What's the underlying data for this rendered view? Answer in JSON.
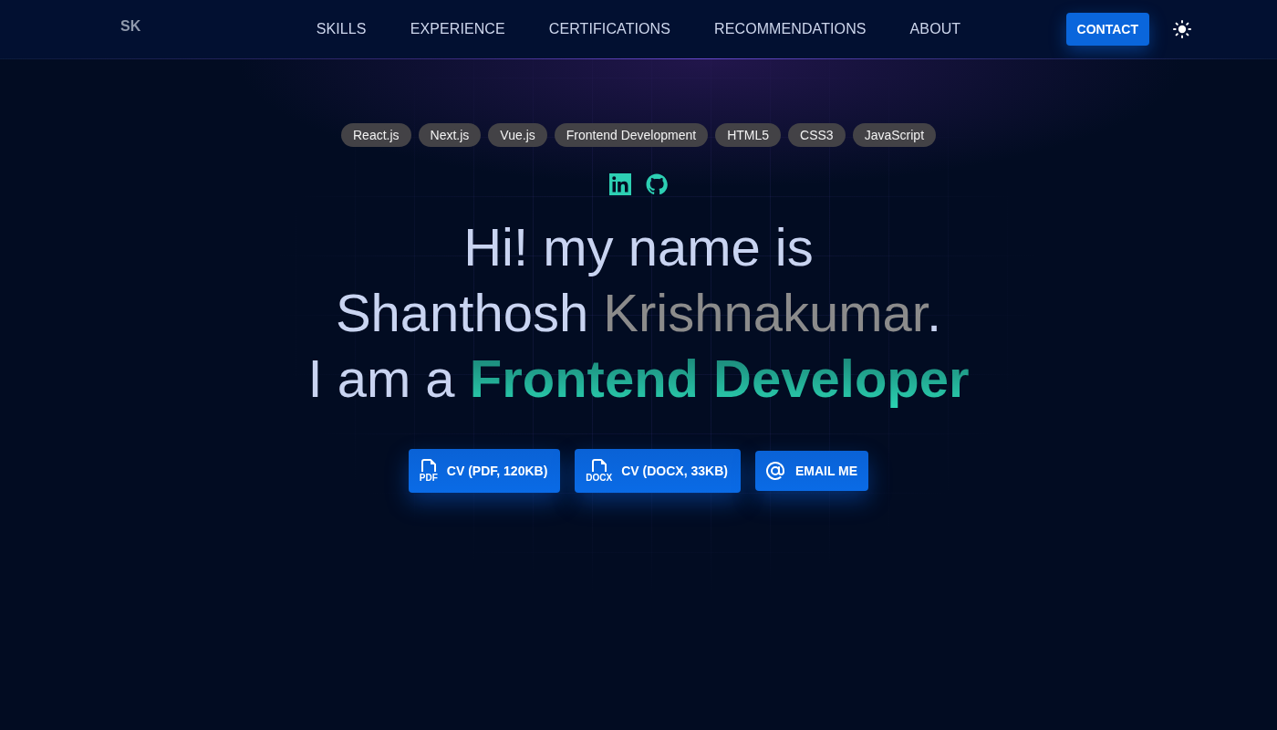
{
  "nav": {
    "logo": "SK",
    "links": [
      {
        "label": "SKILLS"
      },
      {
        "label": "EXPERIENCE"
      },
      {
        "label": "CERTIFICATIONS"
      },
      {
        "label": "RECOMMENDATIONS"
      },
      {
        "label": "ABOUT"
      }
    ],
    "contact_button": "CONTACT"
  },
  "skill_tags": [
    "React.js",
    "Next.js",
    "Vue.js",
    "Frontend Development",
    "HTML5",
    "CSS3",
    "JavaScript"
  ],
  "headline": {
    "lines": [
      [
        {
          "text": "Hi! my name is",
          "kind": "plain"
        }
      ],
      [
        {
          "text": "Shanthosh ",
          "kind": "plain"
        },
        {
          "text": "Krishnakumar",
          "kind": "muted"
        },
        {
          "text": ".",
          "kind": "plain"
        }
      ],
      [
        {
          "text": "I am a ",
          "kind": "plain"
        },
        {
          "text": "Frontend Developer",
          "kind": "accent"
        }
      ]
    ]
  },
  "actions": [
    {
      "kind": "file",
      "icon_label": "PDF",
      "label": "CV (PDF, 120KB)"
    },
    {
      "kind": "file",
      "icon_label": "DOCX",
      "label": "CV (DOCX, 33KB)"
    },
    {
      "kind": "email",
      "label": "EMAIL ME"
    }
  ]
}
